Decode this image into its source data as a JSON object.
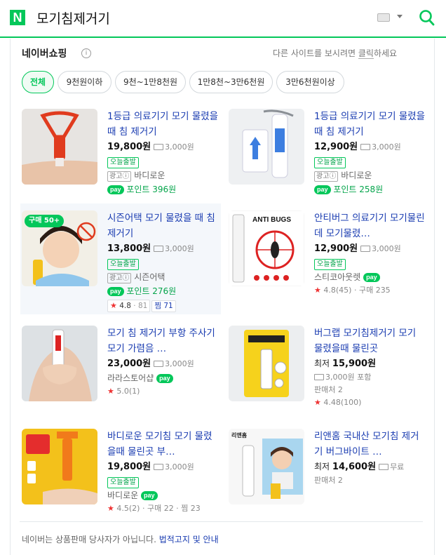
{
  "search": {
    "logo": "N",
    "query": "모기침제거기"
  },
  "section": {
    "title": "네이버쇼핑",
    "notice": "다른 사이트를 보시려면 ",
    "notice_link": "클릭",
    "notice_tail": "하세요"
  },
  "filters": [
    "전체",
    "9천원이하",
    "9천~1만8천원",
    "1만8천~3만6천원",
    "3만6천원이상"
  ],
  "products": [
    {
      "title": "1등급 의료기기 모기 물렸을 때 침 제거기",
      "price": "19,800원",
      "shipping": "3,000원",
      "today": "오늘출발",
      "ad": "광고ⓘ",
      "store": "바디로운",
      "npay": "pay",
      "point": "포인트 396원"
    },
    {
      "title": "1등급 의료기기 모기 물렸을 때 침 제거기",
      "price": "12,900원",
      "shipping": "3,000원",
      "today": "오늘출발",
      "ad": "광고ⓘ",
      "store": "바디로운",
      "npay": "pay",
      "point": "포인트 258원"
    },
    {
      "title": "시즌어택 모기 물렸을 때 침 제거기",
      "price": "13,800원",
      "shipping": "3,000원",
      "today": "오늘출발",
      "ad": "광고ⓘ",
      "store": "시즌어택",
      "npay": "pay",
      "point": "포인트 276원",
      "buy_badge": "구매 50+",
      "rating": "4.8",
      "reviews": "81",
      "zzim_label": "찜",
      "zzim": "71"
    },
    {
      "title": "안티버그 의료기기 모기물린데 모기물렸…",
      "price": "12,900원",
      "shipping": "3,000원",
      "today": "오늘출발",
      "store": "스티코아웃렛",
      "npay": "pay",
      "rating_text": "4.8(45)",
      "purchase": "구매 235",
      "thumb_label": "ANTI BUGS"
    },
    {
      "title": "모기 침 제거기 부항 주사기 모기 가렴음 …",
      "price": "23,000원",
      "shipping": "3,000원",
      "store": "라라스토어샵",
      "npay": "pay",
      "rating_text": "5.0(1)"
    },
    {
      "title": "버그랩 모기침제거기 모기 물렸을때 물린곳",
      "price_prefix": "최저",
      "price": "15,900원",
      "shipping_full": "3,000원 포함",
      "sellers": "판매처 2",
      "rating_text": "4.48(100)"
    },
    {
      "title": "바디로운 모기침 모기 물렸을때 물린곳 부…",
      "price": "19,800원",
      "shipping": "3,000원",
      "today": "오늘출발",
      "store": "바디로운",
      "npay": "pay",
      "rating_text": "4.5(2)",
      "purchase": "구매 22",
      "zzim_text": "찜 23"
    },
    {
      "title": "리앤홈 국내산 모기침 제거기 버그바이트 …",
      "price_prefix": "최저",
      "price": "14,600원",
      "shipping_free": "무료",
      "sellers": "판매처 2",
      "thumb_label": "리앤홈"
    }
  ],
  "footer": {
    "text": "네이버는 상품판매 당사자가 아닙니다. ",
    "link": "법적고지 및 안내"
  },
  "colors": {
    "accent": "#03c75a",
    "link": "#1a3cb1",
    "star": "#ee3333"
  }
}
